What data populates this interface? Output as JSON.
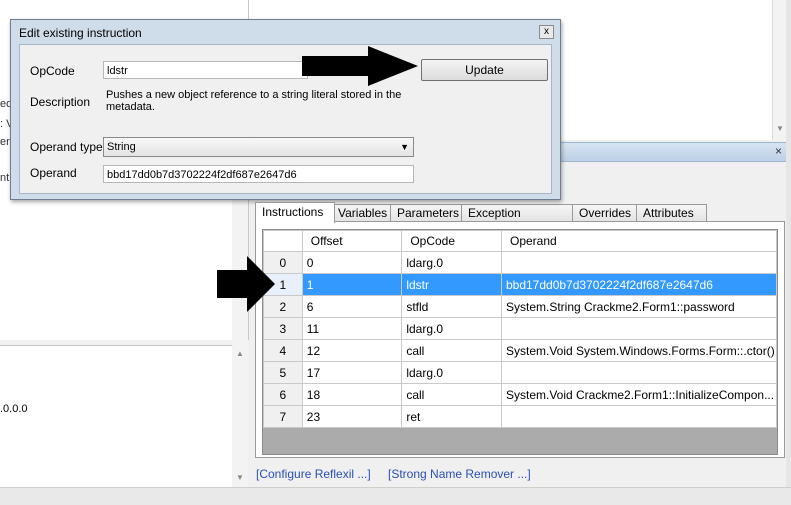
{
  "background": {
    "left_fragments": [
      "ed",
      ": V",
      "ent",
      "nt"
    ],
    "version_fragment": ".0.0.0"
  },
  "tabs": [
    "Instructions",
    "Variables",
    "Parameters",
    "Exception Handlers",
    "Overrides",
    "Attributes"
  ],
  "grid": {
    "columns": [
      "Offset",
      "OpCode",
      "Operand"
    ],
    "rows": [
      {
        "index": "0",
        "offset": "0",
        "opcode": "ldarg.0",
        "operand": ""
      },
      {
        "index": "1",
        "offset": "1",
        "opcode": "ldstr",
        "operand": "bbd17dd0b7d3702224f2df687e2647d6"
      },
      {
        "index": "2",
        "offset": "6",
        "opcode": "stfld",
        "operand": "System.String Crackme2.Form1::password"
      },
      {
        "index": "3",
        "offset": "11",
        "opcode": "ldarg.0",
        "operand": ""
      },
      {
        "index": "4",
        "offset": "12",
        "opcode": "call",
        "operand": "System.Void System.Windows.Forms.Form::.ctor()"
      },
      {
        "index": "5",
        "offset": "17",
        "opcode": "ldarg.0",
        "operand": ""
      },
      {
        "index": "6",
        "offset": "18",
        "opcode": "call",
        "operand": "System.Void Crackme2.Form1::InitializeCompon..."
      },
      {
        "index": "7",
        "offset": "23",
        "opcode": "ret",
        "operand": ""
      }
    ],
    "selected_index": 1
  },
  "links": {
    "configure": "[Configure Reflexil ...]",
    "strong_name": "[Strong Name Remover ...]"
  },
  "dialog": {
    "title": "Edit existing instruction",
    "close_glyph": "x",
    "opcode_label": "OpCode",
    "opcode_value": "ldstr",
    "update_label": "Update",
    "description_label": "Description",
    "description_text": "Pushes a new object reference to a string literal stored in the metadata.",
    "operand_type_label": "Operand type",
    "operand_type_value": "String",
    "operand_label": "Operand",
    "operand_value": "bbd17dd0b7d3702224f2df687e2647d6"
  },
  "panel_close_glyph": "×",
  "colors": {
    "selection": "#3399ff",
    "link": "#2a4fb5",
    "dialog_frame": "#cfdcea",
    "arrow": "#000000"
  }
}
